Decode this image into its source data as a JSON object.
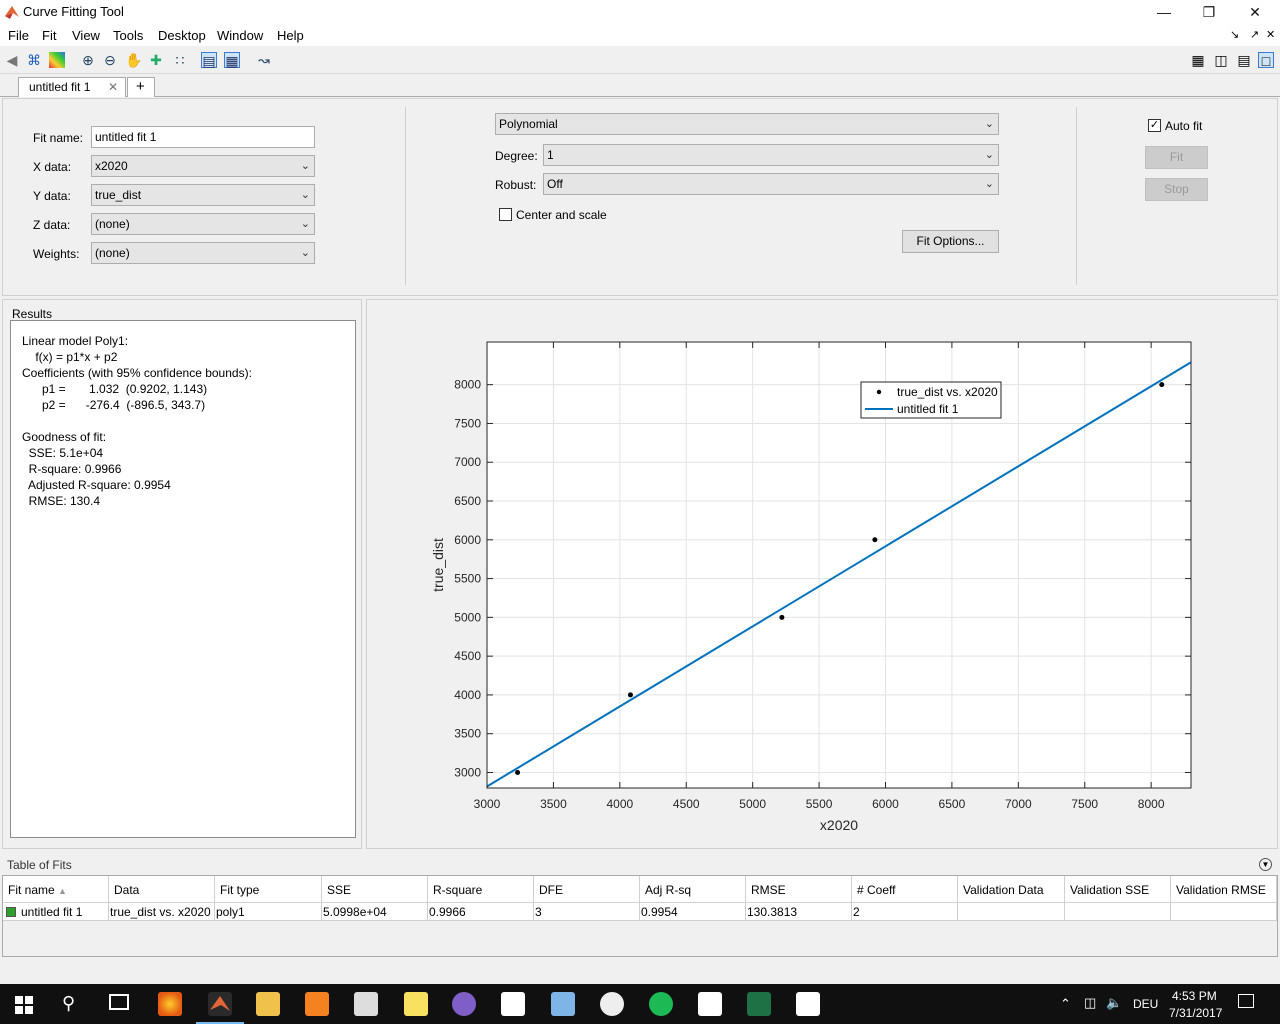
{
  "window": {
    "title": "Curve Fitting Tool"
  },
  "menu": [
    "File",
    "Fit",
    "View",
    "Tools",
    "Desktop",
    "Window",
    "Help"
  ],
  "tabs": {
    "active": "untitled fit 1",
    "add_symbol": "+"
  },
  "data_panel": {
    "fit_name_label": "Fit name:",
    "fit_name_value": "untitled fit 1",
    "x_label": "X data:",
    "x_value": "x2020",
    "y_label": "Y data:",
    "y_value": "true_dist",
    "z_label": "Z data:",
    "z_value": "(none)",
    "w_label": "Weights:",
    "w_value": "(none)"
  },
  "model_panel": {
    "type": "Polynomial",
    "degree_label": "Degree:",
    "degree_value": "1",
    "robust_label": "Robust:",
    "robust_value": "Off",
    "center_scale_label": "Center and scale",
    "fit_options_label": "Fit Options..."
  },
  "actions": {
    "auto_fit_label": "Auto fit",
    "auto_fit_checked": true,
    "fit_label": "Fit",
    "stop_label": "Stop"
  },
  "results": {
    "title": "Results",
    "lines": [
      "Linear model Poly1:",
      "    f(x) = p1*x + p2",
      "Coefficients (with 95% confidence bounds):",
      "      p1 =       1.032  (0.9202, 1.143)",
      "      p2 =      -276.4  (-896.5, 343.7)",
      "",
      "Goodness of fit:",
      "  SSE: 5.1e+04",
      "  R-square: 0.9966",
      "  Adjusted R-square: 0.9954",
      "  RMSE: 130.4"
    ]
  },
  "chart_data": {
    "type": "scatter",
    "xlabel": "x2020",
    "ylabel": "true_dist",
    "xlim": [
      3000,
      8300
    ],
    "ylim": [
      2800,
      8550
    ],
    "xticks": [
      3000,
      3500,
      4000,
      4500,
      5000,
      5500,
      6000,
      6500,
      7000,
      7500,
      8000
    ],
    "yticks": [
      3000,
      3500,
      4000,
      4500,
      5000,
      5500,
      6000,
      6500,
      7000,
      7500,
      8000
    ],
    "grid": true,
    "legend_position": "top-right",
    "series": [
      {
        "name": "true_dist vs. x2020",
        "kind": "points",
        "color": "#000000",
        "x": [
          3230,
          4080,
          5220,
          5920,
          8080
        ],
        "y": [
          3000,
          4000,
          5000,
          6000,
          8000
        ]
      },
      {
        "name": "untitled fit 1",
        "kind": "line",
        "color": "#0072bd",
        "slope": 1.032,
        "intercept": -276.4
      }
    ]
  },
  "table_of_fits": {
    "title": "Table of Fits",
    "columns": [
      "Fit name",
      "Data",
      "Fit type",
      "SSE",
      "R-square",
      "DFE",
      "Adj R-sq",
      "RMSE",
      "# Coeff",
      "Validation Data",
      "Validation SSE",
      "Validation RMSE"
    ],
    "sort_indicator": "▲",
    "rows": [
      [
        "untitled fit 1",
        "true_dist vs. x2020",
        "poly1",
        "5.0998e+04",
        "0.9966",
        "3",
        "0.9954",
        "130.3813",
        "2",
        "",
        "",
        ""
      ]
    ],
    "row_color": "#2ca02c"
  },
  "taskbar": {
    "lang": "DEU",
    "time": "4:53 PM",
    "date": "7/31/2017"
  }
}
